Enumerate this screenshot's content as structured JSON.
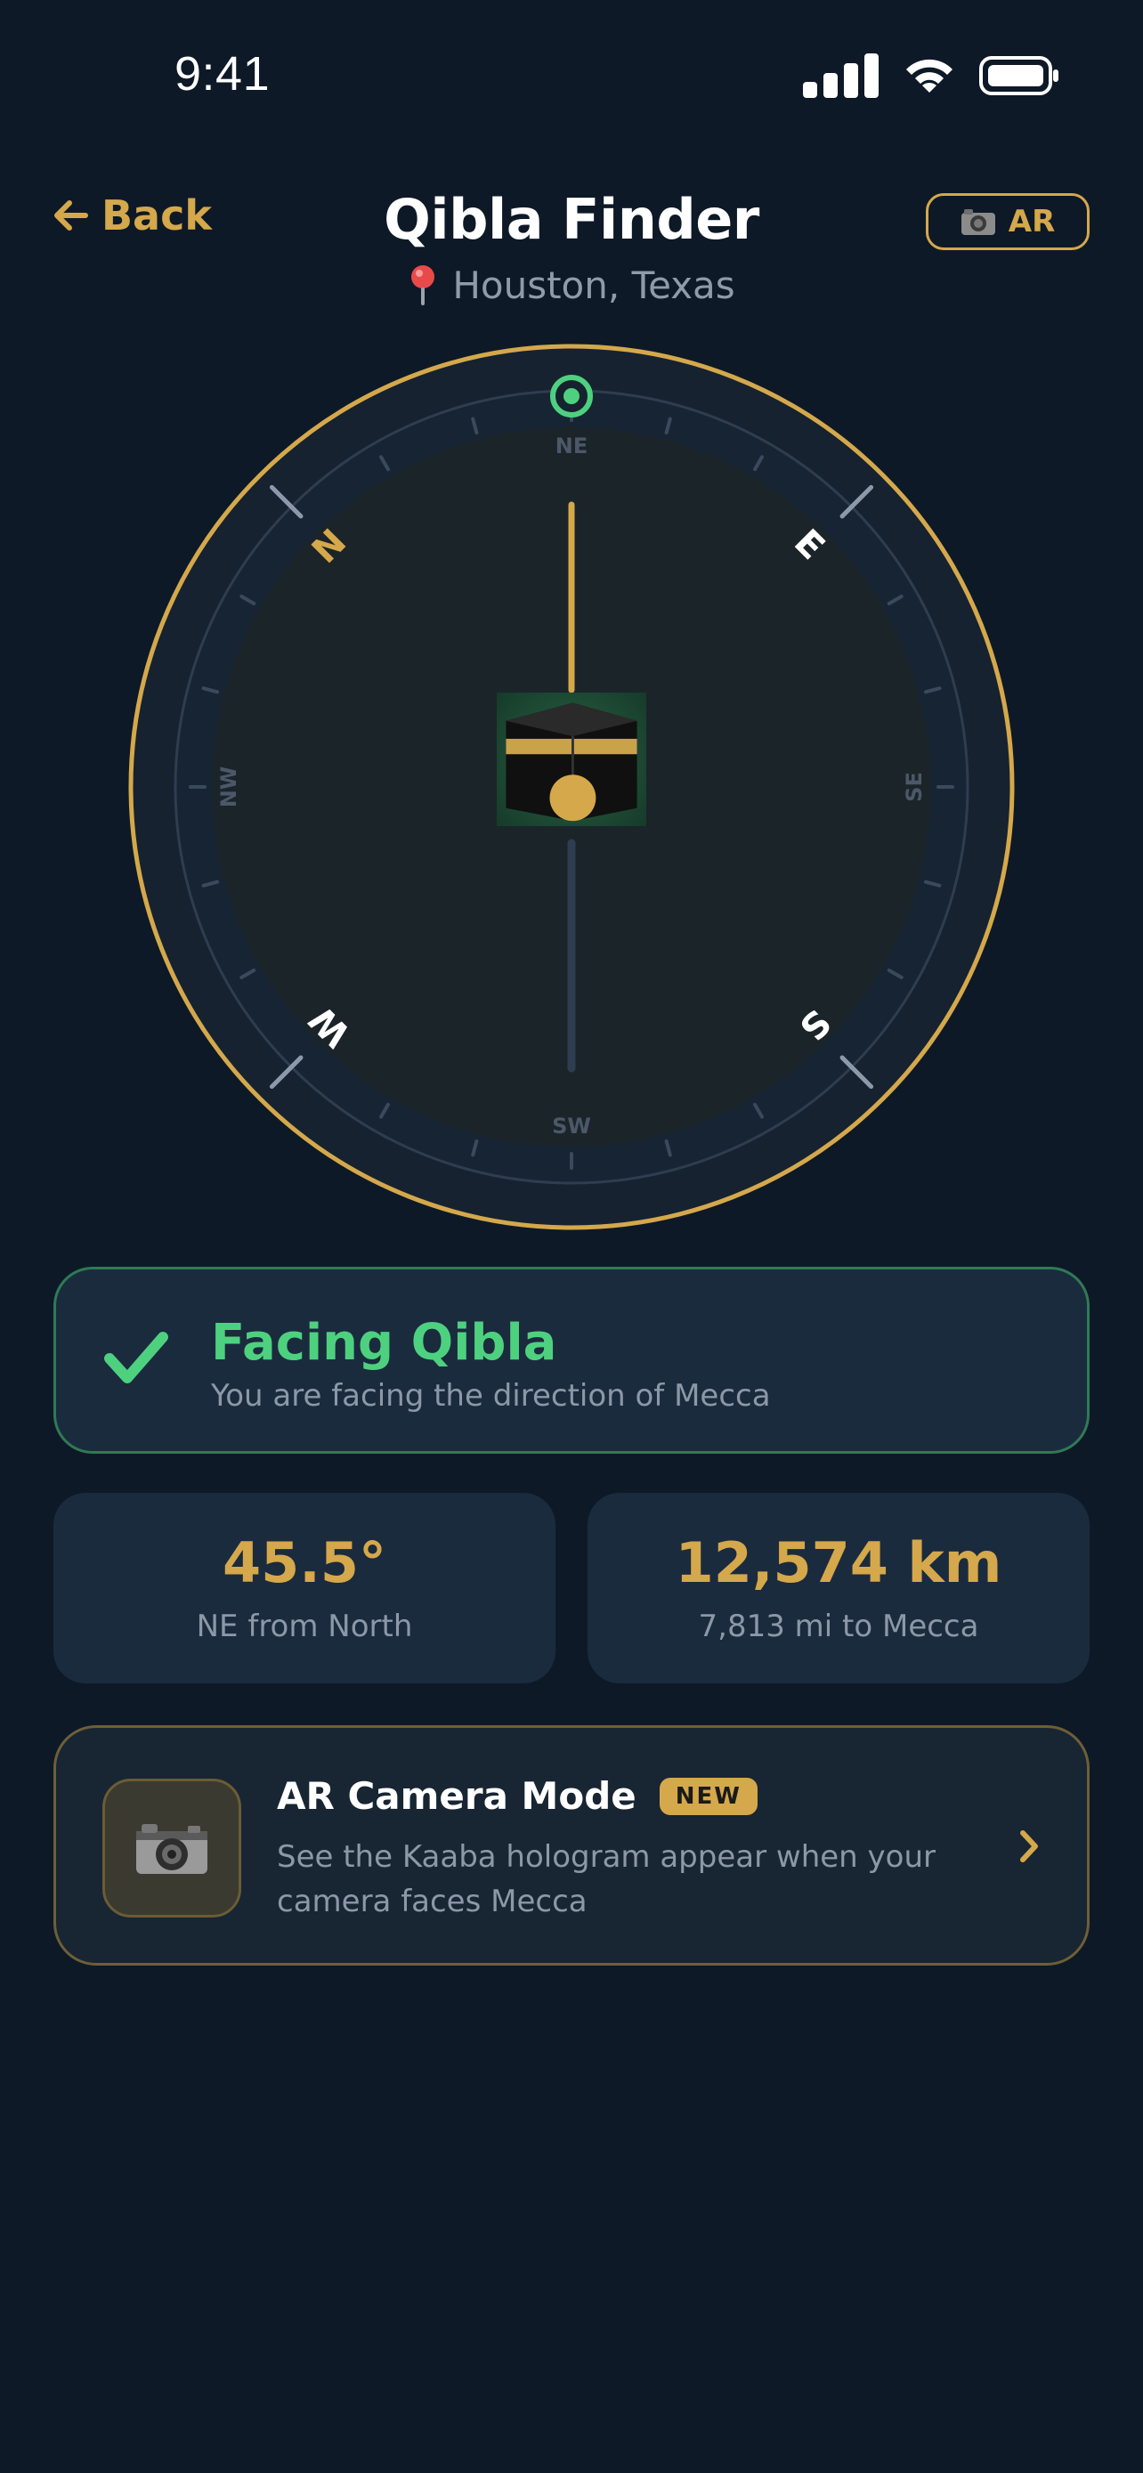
{
  "status_bar": {
    "time": "9:41"
  },
  "header": {
    "back_label": "Back",
    "title": "Qibla Finder",
    "location": "Houston, Texas",
    "ar_button_label": "AR"
  },
  "compass": {
    "heading_deg": 45.5,
    "cardinals": {
      "north": "N",
      "east": "E",
      "south": "S",
      "west": "W"
    },
    "intercardinals": {
      "ne": "NE",
      "se": "SE",
      "sw": "SW",
      "nw": "NW"
    }
  },
  "status_card": {
    "title": "Facing Qibla",
    "subtitle": "You are facing the direction of Mecca"
  },
  "stats": {
    "bearing": {
      "value": "45.5°",
      "label": "NE from North"
    },
    "distance": {
      "value": "12,574 km",
      "label": "7,813 mi to Mecca"
    }
  },
  "ar_card": {
    "title": "AR Camera Mode",
    "badge": "NEW",
    "description": "See the Kaaba hologram appear when your camera faces Mecca"
  },
  "colors": {
    "background": "#0e1927",
    "card": "#1b2b3e",
    "accent_gold": "#d4a84b",
    "success_green": "#4ed17f",
    "muted_text": "#8b98a8"
  },
  "icons": {
    "back": "arrow-left-icon",
    "location": "map-pin-icon",
    "ar": "camera-icon",
    "success": "checkmark-icon",
    "chevron": "chevron-right-icon",
    "qibla_target": "target-dot-icon",
    "center": "kaaba-icon"
  }
}
